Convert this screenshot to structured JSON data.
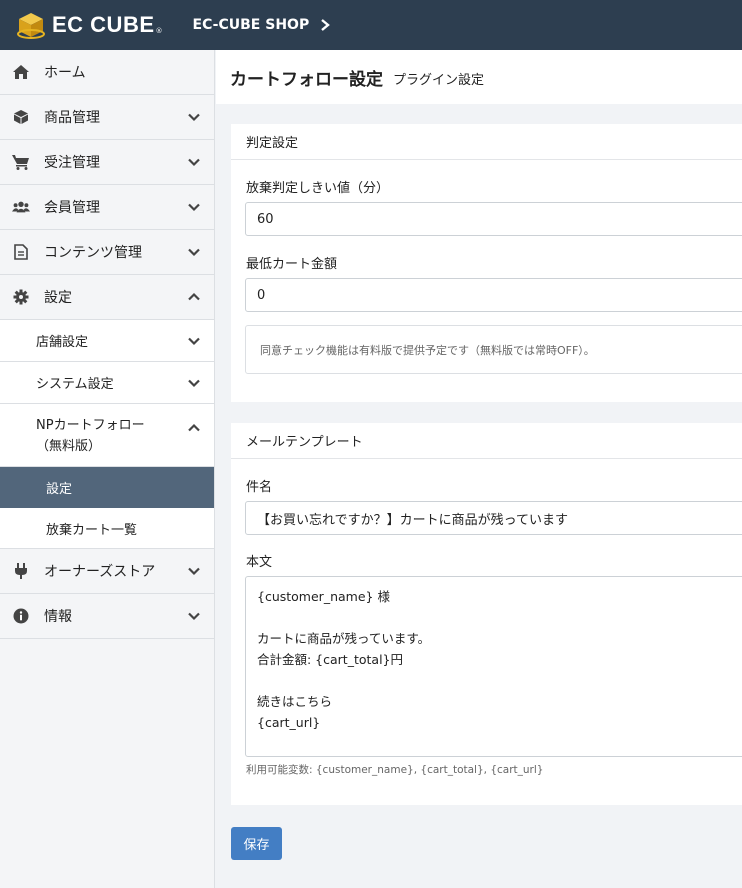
{
  "header": {
    "logo_text": "EC CUBE",
    "logo_registered": "®",
    "shop_name": "EC-CUBE SHOP",
    "shop_chevron_icon": "chevron-right-icon"
  },
  "sidebar": {
    "items": [
      {
        "label": "ホーム",
        "icon": "home-icon"
      },
      {
        "label": "商品管理",
        "icon": "cube-icon"
      },
      {
        "label": "受注管理",
        "icon": "cart-icon"
      },
      {
        "label": "会員管理",
        "icon": "users-icon"
      },
      {
        "label": "コンテンツ管理",
        "icon": "file-icon"
      },
      {
        "label": "設定",
        "icon": "gear-icon"
      },
      {
        "label": "オーナーズストア",
        "icon": "plug-icon"
      },
      {
        "label": "情報",
        "icon": "info-icon"
      }
    ],
    "settings_children": [
      {
        "label": "店舗設定"
      },
      {
        "label": "システム設定"
      },
      {
        "label": "NPカートフォロー（無料版）"
      }
    ],
    "np_children": [
      {
        "label": "設定",
        "active": true
      },
      {
        "label": "放棄カート一覧",
        "active": false
      }
    ]
  },
  "page": {
    "title": "カートフォロー設定",
    "subtitle": "プラグイン設定"
  },
  "judgement": {
    "heading": "判定設定",
    "threshold_label": "放棄判定しきい値（分）",
    "threshold_value": "60",
    "min_amount_label": "最低カート金額",
    "min_amount_value": "0",
    "notice": "同意チェック機能は有料版で提供予定です（無料版では常時OFF）。"
  },
  "mail": {
    "heading": "メールテンプレート",
    "subject_label": "件名",
    "subject_value": "【お買い忘れですか？】カートに商品が残っています",
    "body_label": "本文",
    "body_value": "{customer_name} 様\n\nカートに商品が残っています。\n合計金額: {cart_total}円\n\n続きはこちら\n{cart_url}",
    "variables_hint": "利用可能変数: {customer_name}, {cart_total}, {cart_url}"
  },
  "actions": {
    "save_label": "保存"
  },
  "colors": {
    "header_bg": "#2d3e50",
    "active_nav_bg": "#52667b",
    "primary_button": "#437ec4",
    "logo_gold": "#e6b422"
  }
}
